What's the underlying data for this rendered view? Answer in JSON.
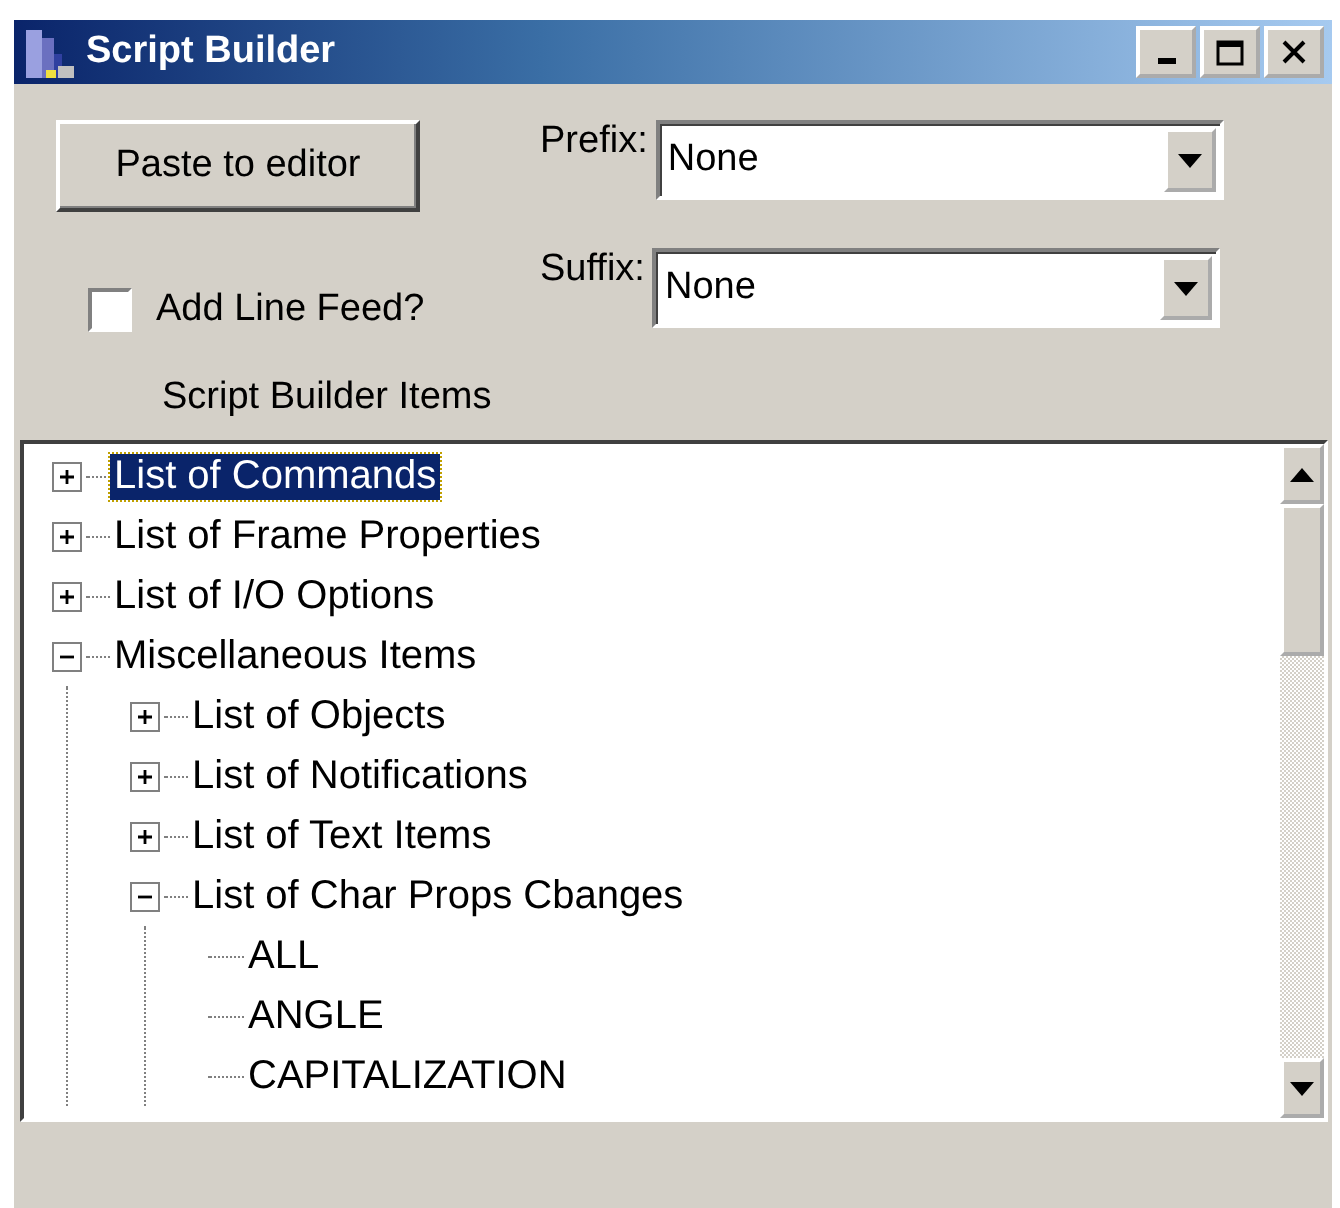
{
  "window": {
    "title": "Script Builder"
  },
  "paste_button": {
    "label": "Paste to editor"
  },
  "prefix": {
    "label": "Prefix:",
    "value": "None"
  },
  "suffix": {
    "label": "Suffix:",
    "value": "None"
  },
  "add_line_feed": {
    "label": "Add Line Feed?",
    "checked": false
  },
  "tree_label": "Script Builder Items",
  "tree": [
    {
      "label": "List of Commands",
      "selected": true,
      "expanded": false
    },
    {
      "label": "List of Frame Properties",
      "selected": false,
      "expanded": false
    },
    {
      "label": "List of I/O Options",
      "selected": false,
      "expanded": false
    },
    {
      "label": "Miscellaneous Items",
      "selected": false,
      "expanded": true,
      "children": [
        {
          "label": "List of Objects",
          "selected": false,
          "expanded": false
        },
        {
          "label": "List of Notifications",
          "selected": false,
          "expanded": false
        },
        {
          "label": "List of Text Items",
          "selected": false,
          "expanded": false
        },
        {
          "label": "List of Char Props Cbanges",
          "selected": false,
          "expanded": true,
          "children": [
            {
              "label": "ALL",
              "selected": false
            },
            {
              "label": "ANGLE",
              "selected": false
            },
            {
              "label": "CAPITALIZATION",
              "selected": false
            }
          ]
        }
      ]
    }
  ]
}
